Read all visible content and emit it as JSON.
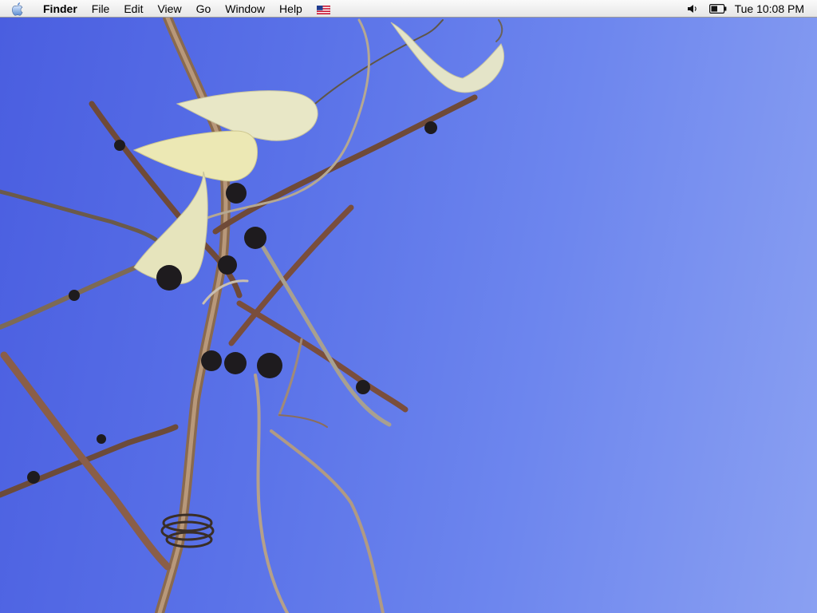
{
  "menubar": {
    "apple_icon": "apple-logo-icon",
    "app_name": "Finder",
    "menus": [
      "File",
      "Edit",
      "View",
      "Go",
      "Window",
      "Help"
    ],
    "input_menu_icon": "us-flag-icon",
    "volume_icon": "speaker-icon",
    "battery_icon": "battery-icon",
    "clock": "Tue 10:08 PM"
  },
  "desktop": {
    "wallpaper": "branches-against-blue-sky",
    "sky_colors": [
      "#4a5ee0",
      "#8aa0f2"
    ]
  }
}
